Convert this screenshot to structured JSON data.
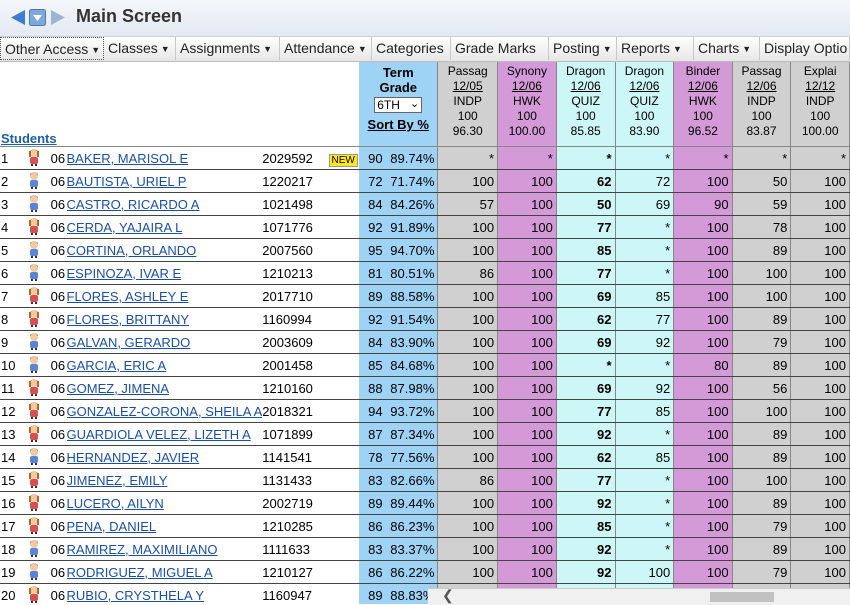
{
  "window": {
    "title": "Main Screen"
  },
  "menu": [
    {
      "label": "Other Access",
      "dropdown": true
    },
    {
      "label": "Classes",
      "dropdown": true
    },
    {
      "label": "Assignments",
      "dropdown": true
    },
    {
      "label": "Attendance",
      "dropdown": true
    },
    {
      "label": "Categories",
      "dropdown": false
    },
    {
      "label": "Grade Marks",
      "dropdown": false
    },
    {
      "label": "Posting",
      "dropdown": true
    },
    {
      "label": "Reports",
      "dropdown": true
    },
    {
      "label": "Charts",
      "dropdown": true
    },
    {
      "label": "Display Optio",
      "dropdown": false
    }
  ],
  "grid": {
    "students_header": "Students",
    "term": {
      "title_line1": "Term",
      "title_line2": "Grade",
      "selected": "6TH",
      "sort_label": "Sort By %"
    },
    "assignments": [
      {
        "name": "Passag",
        "date": "12/05",
        "cat": "INDP",
        "pts": "100",
        "avg": "96.30",
        "color": "#d0d0d0"
      },
      {
        "name": "Synony",
        "date": "12/06",
        "cat": "HWK",
        "pts": "100",
        "avg": "100.00",
        "color": "#d49ad8"
      },
      {
        "name": "Dragon",
        "date": "12/06",
        "cat": "QUIZ",
        "pts": "100",
        "avg": "85.85",
        "color": "#cdf6f6"
      },
      {
        "name": "Dragon",
        "date": "12/06",
        "cat": "QUIZ",
        "pts": "100",
        "avg": "83.90",
        "color": "#cdf6f6"
      },
      {
        "name": "Binder",
        "date": "12/06",
        "cat": "HWK",
        "pts": "100",
        "avg": "96.52",
        "color": "#d49ad8"
      },
      {
        "name": "Passag",
        "date": "12/06",
        "cat": "INDP",
        "pts": "100",
        "avg": "83.87",
        "color": "#d0d0d0"
      },
      {
        "name": "Explai",
        "date": "12/12",
        "cat": "INDP",
        "pts": "100",
        "avg": "100.00",
        "color": "#d0d0d0"
      }
    ],
    "rows": [
      {
        "n": "1",
        "gr": "06",
        "name": "BAKER, MARISOL E",
        "id": "2029592",
        "new": "NEW",
        "tg": "90",
        "pct": "89.74%",
        "scores": [
          "*",
          "*",
          "*",
          "*",
          "*",
          "*",
          "*"
        ]
      },
      {
        "n": "2",
        "gr": "06",
        "name": "BAUTISTA, URIEL P",
        "id": "1220217",
        "new": "",
        "tg": "72",
        "pct": "71.74%",
        "scores": [
          "100",
          "100",
          "62",
          "72",
          "100",
          "50",
          "100"
        ]
      },
      {
        "n": "3",
        "gr": "06",
        "name": "CASTRO, RICARDO A",
        "id": "1021498",
        "new": "",
        "tg": "84",
        "pct": "84.26%",
        "scores": [
          "57",
          "100",
          "50",
          "69",
          "90",
          "59",
          "100"
        ]
      },
      {
        "n": "4",
        "gr": "06",
        "name": "CERDA, YAJAIRA L",
        "id": "1071776",
        "new": "",
        "tg": "92",
        "pct": "91.89%",
        "scores": [
          "100",
          "100",
          "77",
          "*",
          "100",
          "78",
          "100"
        ]
      },
      {
        "n": "5",
        "gr": "06",
        "name": "CORTINA, ORLANDO",
        "id": "2007560",
        "new": "",
        "tg": "95",
        "pct": "94.70%",
        "scores": [
          "100",
          "100",
          "85",
          "*",
          "100",
          "89",
          "100"
        ]
      },
      {
        "n": "6",
        "gr": "06",
        "name": "ESPINOZA, IVAR E",
        "id": "1210213",
        "new": "",
        "tg": "81",
        "pct": "80.51%",
        "scores": [
          "86",
          "100",
          "77",
          "*",
          "100",
          "100",
          "100"
        ]
      },
      {
        "n": "7",
        "gr": "06",
        "name": "FLORES, ASHLEY E",
        "id": "2017710",
        "new": "",
        "tg": "89",
        "pct": "88.58%",
        "scores": [
          "100",
          "100",
          "69",
          "85",
          "100",
          "100",
          "100"
        ]
      },
      {
        "n": "8",
        "gr": "06",
        "name": "FLORES, BRITTANY",
        "id": "1160994",
        "new": "",
        "tg": "92",
        "pct": "91.54%",
        "scores": [
          "100",
          "100",
          "62",
          "77",
          "100",
          "89",
          "100"
        ]
      },
      {
        "n": "9",
        "gr": "06",
        "name": "GALVAN, GERARDO",
        "id": "2003609",
        "new": "",
        "tg": "84",
        "pct": "83.90%",
        "scores": [
          "100",
          "100",
          "69",
          "92",
          "100",
          "79",
          "100"
        ]
      },
      {
        "n": "10",
        "gr": "06",
        "name": "GARCIA, ERIC A",
        "id": "2001458",
        "new": "",
        "tg": "85",
        "pct": "84.68%",
        "scores": [
          "100",
          "100",
          "*",
          "*",
          "80",
          "89",
          "100"
        ]
      },
      {
        "n": "11",
        "gr": "06",
        "name": "GOMEZ, JIMENA",
        "id": "1210160",
        "new": "",
        "tg": "88",
        "pct": "87.98%",
        "scores": [
          "100",
          "100",
          "69",
          "92",
          "100",
          "56",
          "100"
        ]
      },
      {
        "n": "12",
        "gr": "06",
        "name": "GONZALEZ-CORONA, SHEILA A",
        "id": "2018321",
        "new": "",
        "tg": "94",
        "pct": "93.72%",
        "scores": [
          "100",
          "100",
          "77",
          "85",
          "100",
          "100",
          "100"
        ]
      },
      {
        "n": "13",
        "gr": "06",
        "name": "GUARDIOLA VELEZ, LIZETH A",
        "id": "1071899",
        "new": "",
        "tg": "87",
        "pct": "87.34%",
        "scores": [
          "100",
          "100",
          "92",
          "*",
          "100",
          "89",
          "100"
        ]
      },
      {
        "n": "14",
        "gr": "06",
        "name": "HERNANDEZ, JAVIER",
        "id": "1141541",
        "new": "",
        "tg": "78",
        "pct": "77.56%",
        "scores": [
          "100",
          "100",
          "62",
          "85",
          "100",
          "89",
          "100"
        ]
      },
      {
        "n": "15",
        "gr": "06",
        "name": "JIMENEZ, EMILY",
        "id": "1131433",
        "new": "",
        "tg": "83",
        "pct": "82.66%",
        "scores": [
          "86",
          "100",
          "77",
          "*",
          "100",
          "100",
          "100"
        ]
      },
      {
        "n": "16",
        "gr": "06",
        "name": "LUCERO, AILYN",
        "id": "2002719",
        "new": "",
        "tg": "89",
        "pct": "89.44%",
        "scores": [
          "100",
          "100",
          "92",
          "*",
          "100",
          "89",
          "100"
        ]
      },
      {
        "n": "17",
        "gr": "06",
        "name": "PENA, DANIEL",
        "id": "1210285",
        "new": "",
        "tg": "86",
        "pct": "86.23%",
        "scores": [
          "100",
          "100",
          "85",
          "*",
          "100",
          "79",
          "100"
        ]
      },
      {
        "n": "18",
        "gr": "06",
        "name": "RAMIREZ, MAXIMILIANO",
        "id": "1111633",
        "new": "",
        "tg": "83",
        "pct": "83.37%",
        "scores": [
          "100",
          "100",
          "92",
          "*",
          "100",
          "89",
          "100"
        ]
      },
      {
        "n": "19",
        "gr": "06",
        "name": "RODRIGUEZ, MIGUEL A",
        "id": "1210127",
        "new": "",
        "tg": "86",
        "pct": "86.22%",
        "scores": [
          "100",
          "100",
          "92",
          "100",
          "100",
          "79",
          "100"
        ]
      },
      {
        "n": "20",
        "gr": "06",
        "name": "RUBIO, CRYSTHELA Y",
        "id": "1160947",
        "new": "",
        "tg": "89",
        "pct": "88.83%",
        "scores": [
          "",
          "",
          "",
          "",
          "",
          "",
          ""
        ]
      }
    ]
  },
  "avatars": {
    "girl_hair": "#b5651d",
    "boy_hair": "#555555"
  }
}
